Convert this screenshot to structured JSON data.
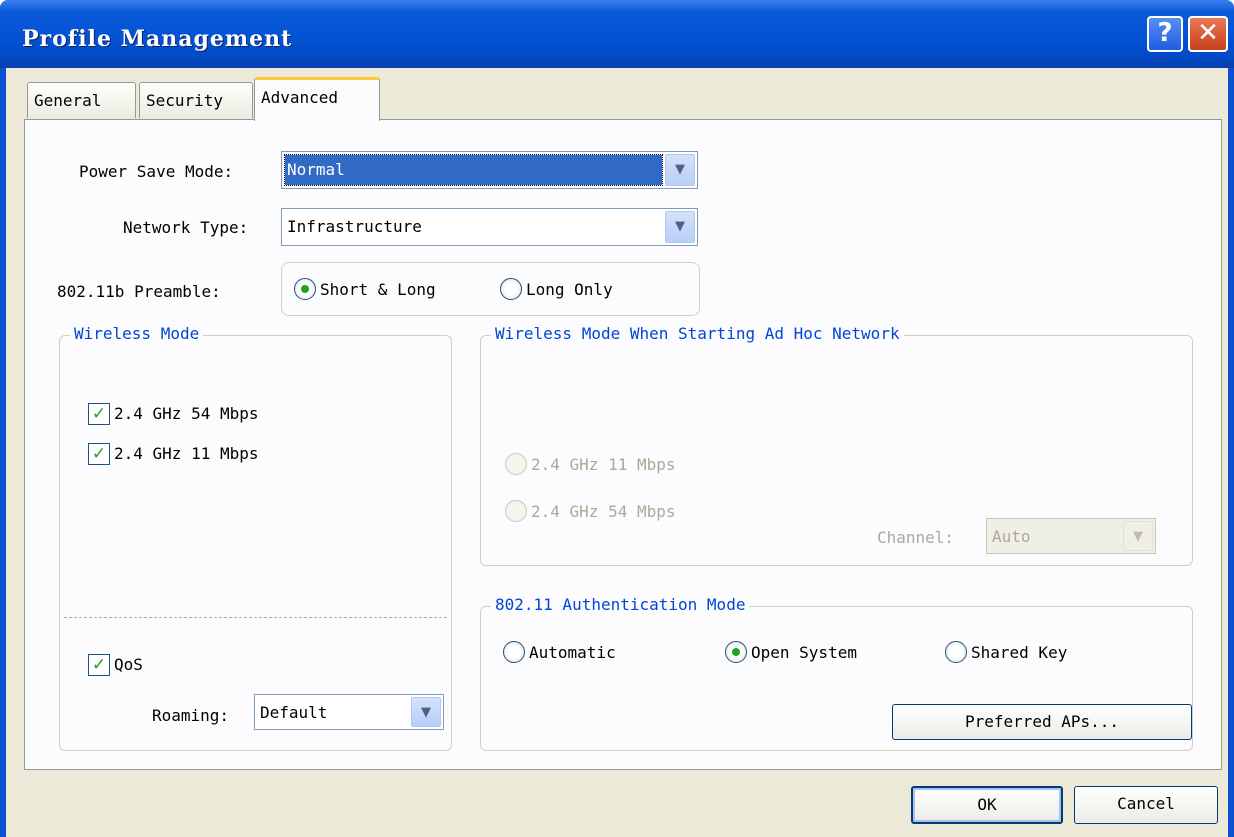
{
  "window": {
    "title": "Profile Management",
    "help_button": "?",
    "close_button": "✕"
  },
  "tabs": [
    {
      "label": "General",
      "active": false
    },
    {
      "label": "Security",
      "active": false
    },
    {
      "label": "Advanced",
      "active": true
    }
  ],
  "advanced": {
    "power_save": {
      "label": "Power Save Mode:",
      "value": "Normal"
    },
    "network_type": {
      "label": "Network Type:",
      "value": "Infrastructure"
    },
    "preamble": {
      "label": "802.11b Preamble:",
      "options": [
        "Short & Long",
        "Long Only"
      ],
      "selected": "Short & Long"
    },
    "wireless_mode": {
      "legend": "Wireless Mode",
      "options": [
        {
          "label": "2.4 GHz 54 Mbps",
          "checked": true
        },
        {
          "label": "2.4 GHz 11 Mbps",
          "checked": true
        }
      ],
      "qos": {
        "label": "QoS",
        "checked": true
      }
    },
    "adhoc_mode": {
      "legend": "Wireless Mode When Starting Ad Hoc Network",
      "options": [
        "2.4 GHz 11 Mbps",
        "2.4 GHz 54 Mbps"
      ],
      "enabled": false,
      "channel_label": "Channel:",
      "channel_value": "Auto"
    },
    "auth_mode": {
      "legend": "802.11 Authentication Mode",
      "options": [
        "Automatic",
        "Open System",
        "Shared Key"
      ],
      "selected": "Open System"
    },
    "roaming": {
      "label": "Roaming:",
      "value": "Default"
    },
    "preferred_aps_button": "Preferred APs..."
  },
  "footer": {
    "ok_label": "OK",
    "cancel_label": "Cancel"
  },
  "colors": {
    "titlebar": "#0454d6",
    "dialog_bg": "#ece9d8",
    "group_legend": "#0046d5",
    "selection": "#316ac5"
  }
}
